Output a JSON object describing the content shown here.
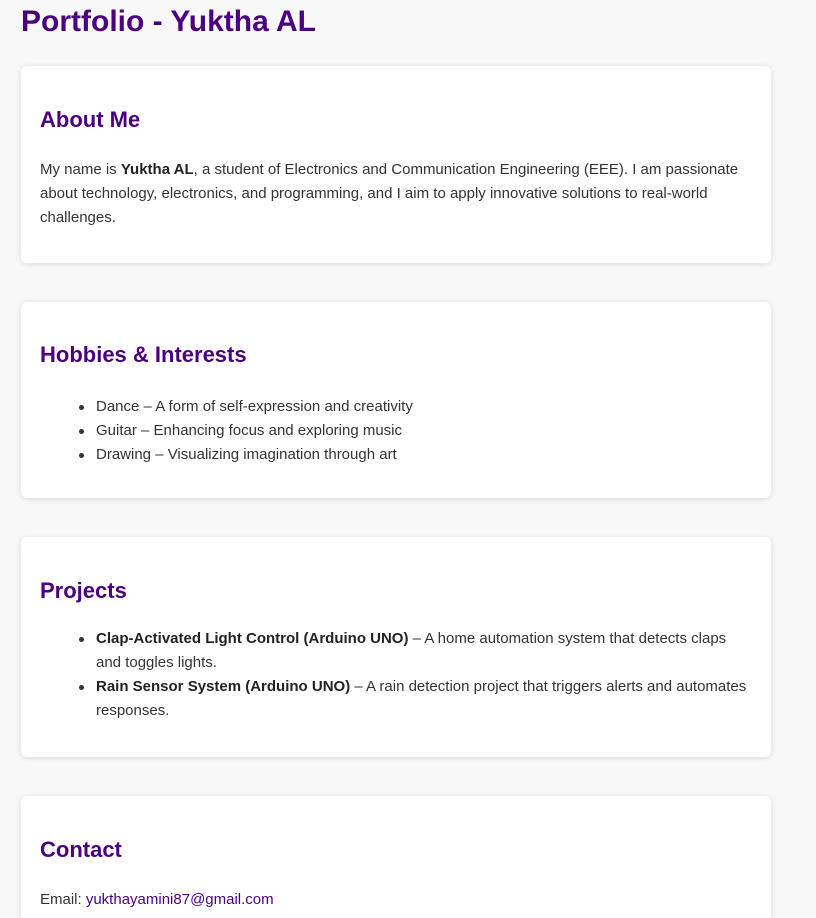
{
  "header": {
    "title": "Portfolio - Yuktha AL"
  },
  "about": {
    "heading": "About Me",
    "text_before": "My name is ",
    "name": "Yuktha AL",
    "text_after": ", a student of Electronics and Communication Engineering (EEE). I am passionate about technology, electronics, and programming, and I aim to apply innovative solutions to real-world challenges."
  },
  "hobbies": {
    "heading": "Hobbies & Interests",
    "items": [
      "Dance – A form of self-expression and creativity",
      "Guitar – Enhancing focus and exploring music",
      "Drawing – Visualizing imagination through art"
    ]
  },
  "projects": {
    "heading": "Projects",
    "items": [
      {
        "title": "Clap-Activated Light Control (Arduino UNO)",
        "description": " – A home automation system that detects claps and toggles lights."
      },
      {
        "title": "Rain Sensor System (Arduino UNO)",
        "description": " – A rain detection project that triggers alerts and automates responses."
      }
    ]
  },
  "contact": {
    "heading": "Contact",
    "email_label": "Email: ",
    "email": "yukthayamini87@gmail.com"
  },
  "colors": {
    "heading": "#4b0082",
    "background": "#f8f8f8",
    "card": "#ffffff",
    "text": "#333333"
  }
}
